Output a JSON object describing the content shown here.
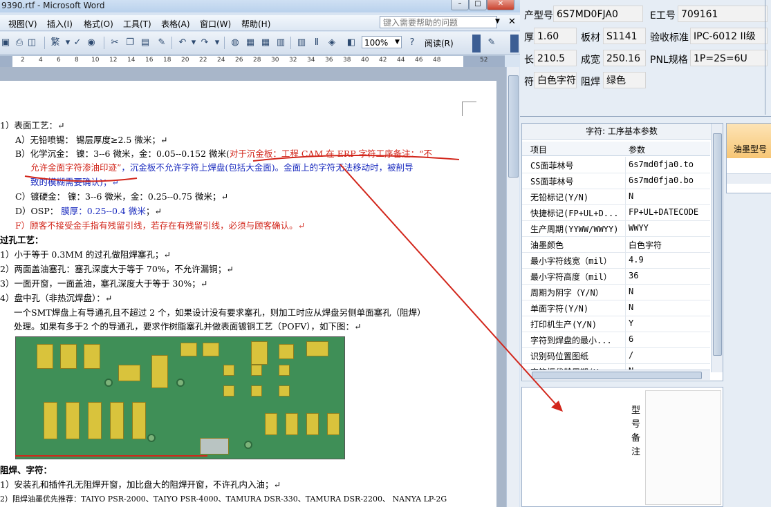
{
  "word": {
    "title": "9390.rtf - Microsoft Word",
    "menu": [
      "视图(V)",
      "插入(I)",
      "格式(O)",
      "工具(T)",
      "表格(A)",
      "窗口(W)",
      "帮助(H)"
    ],
    "help_placeholder": "键入需要帮助的问题",
    "zoom": "100%",
    "read_label": "阅读(R)",
    "ruler_numbers": [
      "2",
      "4",
      "6",
      "8",
      "10",
      "12",
      "14",
      "16",
      "18",
      "20",
      "22",
      "24",
      "26",
      "28",
      "30",
      "32",
      "34",
      "36",
      "38",
      "40",
      "42",
      "44",
      "46",
      "48",
      "52"
    ],
    "doc": {
      "l1": "1）表面工艺：↵",
      "l2": "A）无铅喷锡：  锡层厚度≥2.5 微米；↵",
      "l3a": "B）化学沉金：  镍：3--6 微米，金：0.05--0.152 微米(",
      "l3b": "对于沉金板：工程 CAM 在 ERP 字符工序备注：“不",
      "l4a": "允许金面字符渗油印迹”",
      "l4b": "，沉金板不允许字符上焊盘(包括大金面)。金面上的字符无法移动时，被削导",
      "l5": "致的模糊需要确认)；↵",
      "l6": "C）镀硬金：    镍：3--6 微米，金：0.25--0.75 微米；↵",
      "l7a": "D）OSP：       ",
      "l7b": "膜厚：0.25--0.4 微米",
      "l7c": "；↵",
      "l8": "F）顾客不接受金手指有残留引线，若存在有残留引线，必须与顾客确认。↵",
      "l9": "过孔工艺：",
      "l10": "1）小于等于 0.3MM 的过孔做阻焊塞孔；↵",
      "l11": "2）两面盖油塞孔：塞孔深度大于等于 70%，不允许漏铜；↵",
      "l12": "3）一面开窗，一面盖油，塞孔深度大于等于 30%；↵",
      "l13": "4）盘中孔（非热沉焊盘）：↵",
      "l14": "一个SMT焊盘上有导通孔且不超过  2 个，如果设计没有要求塞孔，则加工时应从焊盘另侧单面塞孔（阻焊）",
      "l15": "处理。如果有多于2  个的导通孔，要求作树脂塞孔并做表面镀铜工艺（POFV），如下图：↵",
      "l16": "阻焊、字符：",
      "l17": "1）安装孔和插件孔无阻焊开窗，加比盘大的阻焊开窗，不许孔内入油；↵",
      "l18": "2）阻焊油墨优先推荐：TAIYO PSR-2000、TAIYO PSR-4000、TAMURA   DSR-330、TAMURA DSR-2200、  NANYA LP-2G"
    }
  },
  "erp": {
    "row1": {
      "l1": "产型号",
      "v1": "6S7MD0FJA0",
      "l2": "E工号",
      "v2": "709161"
    },
    "row2": {
      "l1": "厚",
      "v1": "1.60",
      "l2": "板材",
      "v2": "S1141",
      "l3": "验收标准",
      "v3": "IPC-6012 II级"
    },
    "row3": {
      "l1": "长",
      "v1": "210.5",
      "l2": "成宽",
      "v2": "250.16",
      "l3": "PNL规格",
      "v3": "1P=2S=6U"
    },
    "row4": {
      "l1": "符",
      "v1": "白色字符",
      "l2": "阻焊",
      "v2": "绿色"
    },
    "param_title": "字符: 工序基本参数",
    "col_item": "项目",
    "col_param": "参数",
    "params": [
      {
        "name": "CS面菲林号",
        "value": "6s7md0fja0.to"
      },
      {
        "name": "SS面菲林号",
        "value": "6s7md0fja0.bo"
      },
      {
        "name": "无铅标记(Y/N)",
        "value": "N"
      },
      {
        "name": "快捷标记(FP+UL+D...",
        "value": "FP+UL+DATECODE"
      },
      {
        "name": "生产周期(YYWW/WWYY)",
        "value": "WWYY"
      },
      {
        "name": "油墨颜色",
        "value": "白色字符"
      },
      {
        "name": "最小字符线宽（mil）",
        "value": "4.9"
      },
      {
        "name": "最小字符高度（mil）",
        "value": "36"
      },
      {
        "name": "周期为阴字（Y/N）",
        "value": "N"
      },
      {
        "name": "单面字符(Y/N)",
        "value": "N"
      },
      {
        "name": "打印机生产(Y/N)",
        "value": "Y"
      },
      {
        "name": "字符到焊盘的最小...",
        "value": "6"
      },
      {
        "name": "识别码位置图纸",
        "value": "/"
      },
      {
        "name": "字符框代替周期(Y...",
        "value": "N"
      }
    ],
    "ink_label": "油墨型号",
    "note_label": "型号备注"
  },
  "colors": {
    "annotation": "#d2261b",
    "ink_header": "#f7c675"
  }
}
